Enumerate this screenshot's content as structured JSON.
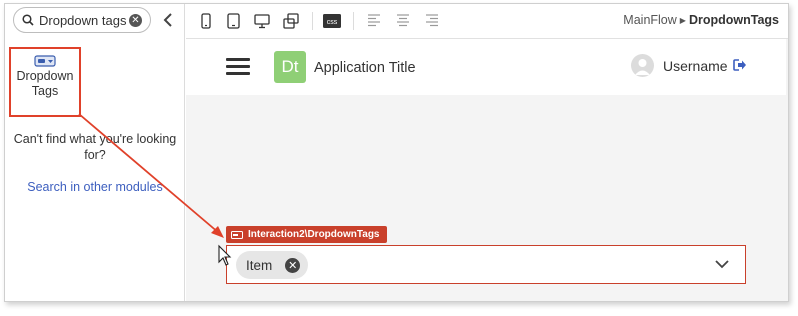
{
  "sidebar": {
    "search_value": "Dropdown tags",
    "widget_label": "Dropdown Tags",
    "not_found_text": "Can't find what you're looking for?",
    "search_other_link": "Search in other modules"
  },
  "toolbar": {
    "css_label": "css",
    "breadcrumb": {
      "parent": "MainFlow",
      "current": "DropdownTags"
    }
  },
  "app": {
    "logo_text": "Dt",
    "title": "Application Title",
    "username": "Username"
  },
  "widget_instance": {
    "tag_label": "Interaction2\\DropdownTags",
    "chip_text": "Item"
  },
  "colors": {
    "accent_red": "#c9402b",
    "logo_green": "#8fcf76",
    "link_blue": "#3d5fbf"
  }
}
